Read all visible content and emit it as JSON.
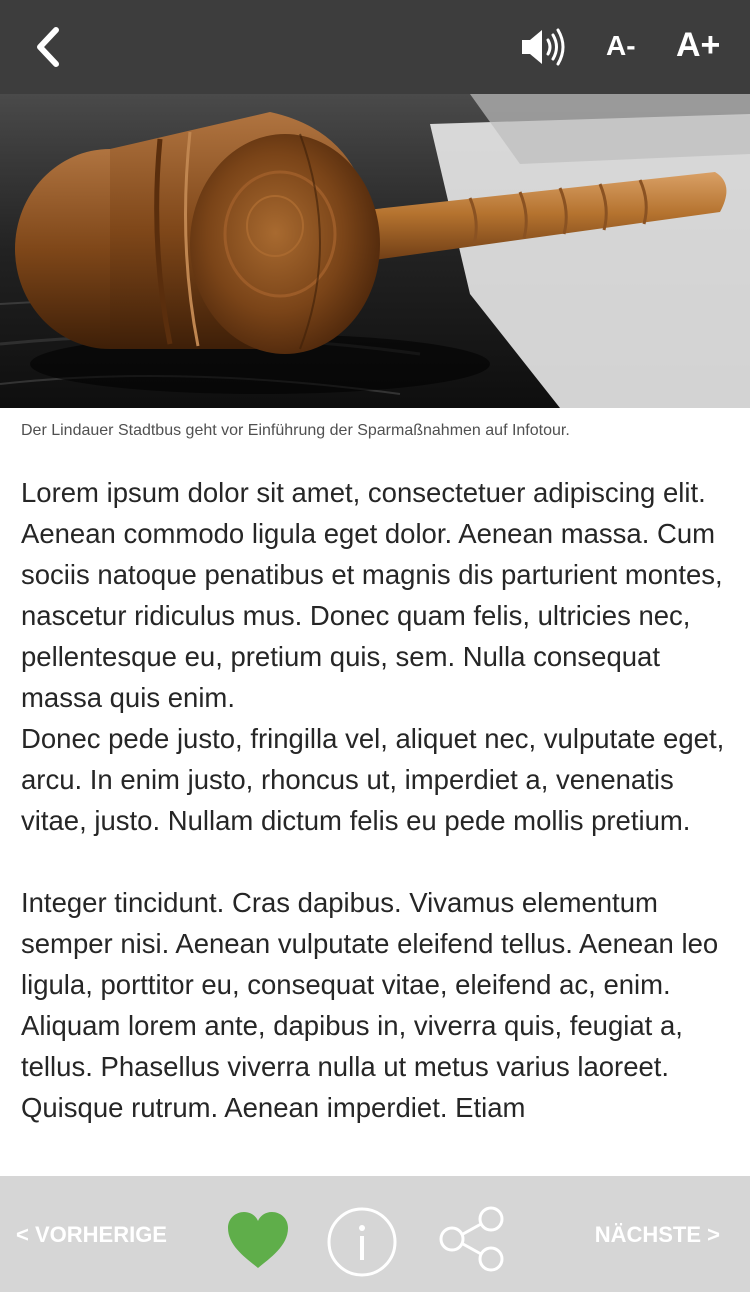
{
  "header": {
    "back_icon": "chevron-left-icon",
    "speaker_icon": "speaker-icon",
    "font_decrease_label": "A-",
    "font_increase_label": "A+"
  },
  "hero": {
    "image_subject": "wooden judge gavel on dark wood desk"
  },
  "caption": "Der Lindauer Stadtbus geht vor Einführung der Sparmaßnahmen auf Infotour.",
  "article": {
    "paragraph1": "Lorem ipsum dolor sit amet, consectetuer adipiscing elit. Aenean commodo ligula eget dolor. Aenean massa. Cum sociis natoque penatibus et magnis dis parturient montes, nascetur ridiculus mus. Donec quam felis, ultricies nec, pellentesque eu, pretium quis, sem. Nulla consequat massa quis enim.",
    "paragraph2": "Donec pede justo, fringilla vel, aliquet nec, vulputate eget, arcu. In enim justo, rhoncus ut, imperdiet a, venenatis vitae, justo. Nullam dictum felis eu pede mollis pretium.",
    "paragraph3": "Integer tincidunt. Cras dapibus. Vivamus elementum semper nisi. Aenean vulputate eleifend tellus. Aenean leo ligula, porttitor eu, consequat vitae, eleifend ac, enim. Aliquam lorem ante, dapibus in, viverra quis, feugiat a, tellus. Phasellus viverra nulla ut metus varius laoreet. Quisque rutrum. Aenean imperdiet. Etiam"
  },
  "footer": {
    "prev_label": "< VORHERIGE",
    "next_label": "NÄCHSTE >",
    "heart_icon": "heart-icon",
    "info_icon": "info-icon",
    "share_icon": "share-icon"
  },
  "colors": {
    "topbar": "#3d3d3d",
    "bottombar": "#d6d6d6",
    "heart": "#5fae4a",
    "text": "#262626"
  }
}
